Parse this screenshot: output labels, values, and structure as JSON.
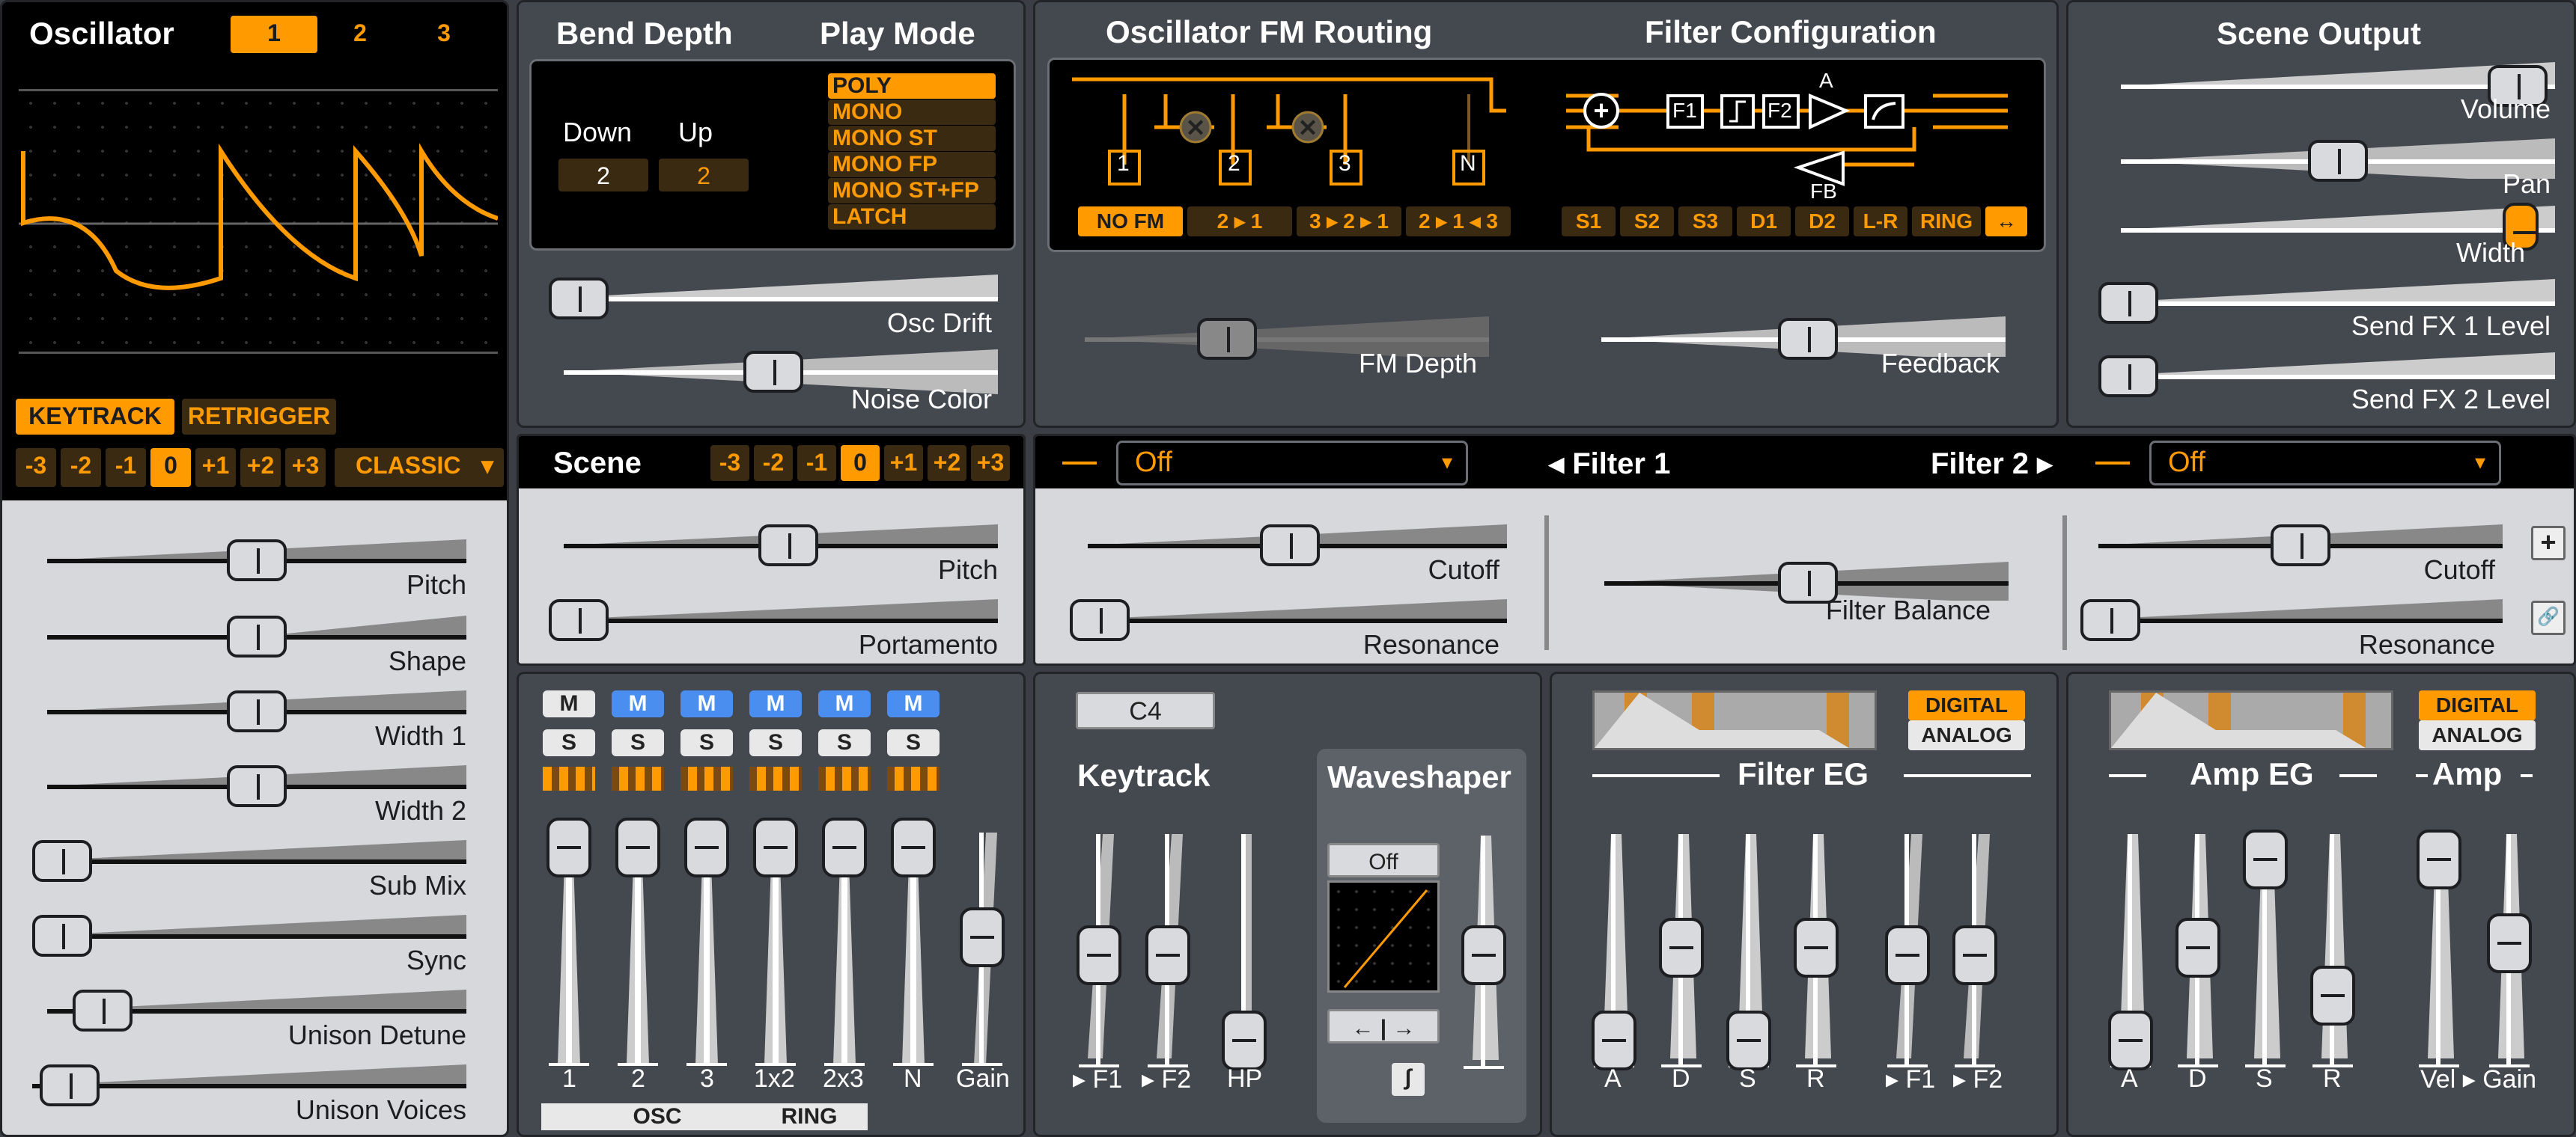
{
  "osc": {
    "title": "Oscillator",
    "tabs": [
      "1",
      "2",
      "3"
    ],
    "keytrack": "KEYTRACK",
    "retrigger": "RETRIGGER",
    "octaves": [
      "-3",
      "-2",
      "-1",
      "0",
      "+1",
      "+2",
      "+3"
    ],
    "type": "CLASSIC",
    "sliders": [
      "Pitch",
      "Shape",
      "Width 1",
      "Width 2",
      "Sub Mix",
      "Sync",
      "Unison Detune",
      "Unison Voices"
    ]
  },
  "bend": {
    "title": "Bend Depth",
    "down_label": "Down",
    "up_label": "Up",
    "down": "2",
    "up": "2"
  },
  "play": {
    "title": "Play Mode",
    "modes": [
      "POLY",
      "MONO",
      "MONO ST",
      "MONO FP",
      "MONO ST+FP",
      "LATCH"
    ]
  },
  "drift": {
    "osc_drift": "Osc Drift",
    "noise_color": "Noise Color"
  },
  "fm": {
    "title": "Oscillator FM Routing",
    "nodes": [
      "1",
      "2",
      "3",
      "N"
    ],
    "routes": [
      "NO FM",
      "2 ▸ 1",
      "3 ▸ 2 ▸ 1",
      "2 ▸ 1 ◂ 3"
    ],
    "depth": "FM Depth"
  },
  "filtcfg": {
    "title": "Filter Configuration",
    "blocks": [
      "F1",
      "F2",
      "A",
      "FB"
    ],
    "routes": [
      "S1",
      "S2",
      "S3",
      "D1",
      "D2",
      "L-R",
      "RING",
      "↔"
    ],
    "feedback": "Feedback"
  },
  "out": {
    "title": "Scene Output",
    "sliders": [
      "Volume",
      "Pan",
      "Width",
      "Send FX 1 Level",
      "Send FX 2 Level"
    ]
  },
  "scene": {
    "title": "Scene",
    "octaves": [
      "-3",
      "-2",
      "-1",
      "0",
      "+1",
      "+2",
      "+3"
    ],
    "pitch": "Pitch",
    "portamento": "Portamento"
  },
  "filters": {
    "f1_type": "Off",
    "f1_label": "◂ Filter 1",
    "f2_label": "Filter 2 ▸",
    "f2_type": "Off",
    "cutoff": "Cutoff",
    "resonance": "Resonance",
    "balance": "Filter Balance",
    "plus": "+",
    "link": "🔗"
  },
  "mixer": {
    "m": "M",
    "s": "S",
    "channels": [
      "1",
      "2",
      "3",
      "1x2",
      "2x3",
      "N",
      "Gain"
    ],
    "osc": "OSC",
    "ring": "RING"
  },
  "keytrack": {
    "note": "C4",
    "title": "Keytrack",
    "faders": [
      "▸ F1",
      "▸ F2",
      "HP"
    ]
  },
  "ws": {
    "title": "Waveshaper",
    "type": "Off",
    "arrows": "← | →"
  },
  "feg": {
    "title": "Filter EG",
    "digital": "DIGITAL",
    "analog": "ANALOG",
    "faders": [
      "A",
      "D",
      "S",
      "R",
      "▸ F1",
      "▸ F2"
    ]
  },
  "aeg": {
    "title": "Amp EG",
    "amp": "Amp",
    "digital": "DIGITAL",
    "analog": "ANALOG",
    "faders": [
      "A",
      "D",
      "S",
      "R",
      "Vel ▸ Gain"
    ]
  },
  "colors": {
    "accent": "#ff9a00",
    "panel": "#44484f",
    "light": "#d6d8dc",
    "blue": "#4a8ef0"
  }
}
